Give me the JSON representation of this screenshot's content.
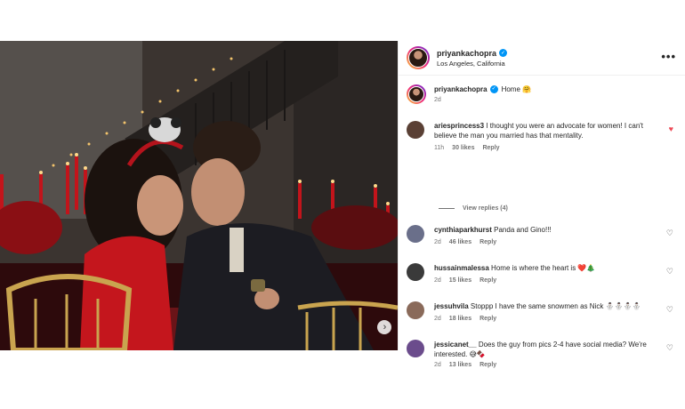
{
  "post_header": {
    "username": "priyankachopra",
    "location": "Los Angeles, California",
    "verified_glyph": "✓",
    "more_glyph": "•••"
  },
  "photo": {
    "next_glyph": "›"
  },
  "caption": {
    "username": "priyankachopra",
    "text": "Home 🤗",
    "time": "2d"
  },
  "comments": [
    {
      "username": "ariesprincess3",
      "text": "I thought you were an advocate for women! I can't believe the man you married has that mentality.",
      "time": "11h",
      "likes": "30 likes",
      "reply": "Reply",
      "liked": true,
      "avatar_color": "#5a4035"
    },
    {
      "username": "cynthiaparkhurst",
      "text": "Panda and Gino!!!",
      "time": "2d",
      "likes": "46 likes",
      "reply": "Reply",
      "liked": false,
      "avatar_color": "#6a6f8a"
    },
    {
      "username": "hussainmalessa",
      "text": "Home is where the heart is ❤️🎄",
      "time": "2d",
      "likes": "15 likes",
      "reply": "Reply",
      "liked": false,
      "avatar_color": "#3a3a3a"
    },
    {
      "username": "jessuhvila",
      "text": "Stoppp I have the same snowmen as Nick ⛄⛄⛄⛄",
      "time": "2d",
      "likes": "18 likes",
      "reply": "Reply",
      "liked": false,
      "avatar_color": "#8a6a5a"
    },
    {
      "username": "jessicanet__",
      "text": "Does the guy from pics 2-4 have social media? We're interested. 😅🍫",
      "time": "2d",
      "likes": "13 likes",
      "reply": "Reply",
      "liked": false,
      "avatar_color": "#6b4c8c"
    }
  ],
  "view_replies": "View replies (4)",
  "icons": {
    "heart_outline": "♡",
    "heart_filled": "♥"
  },
  "colors": {
    "verified_blue": "#0095f6",
    "like_red": "#ed4956",
    "meta_gray": "#737373"
  }
}
